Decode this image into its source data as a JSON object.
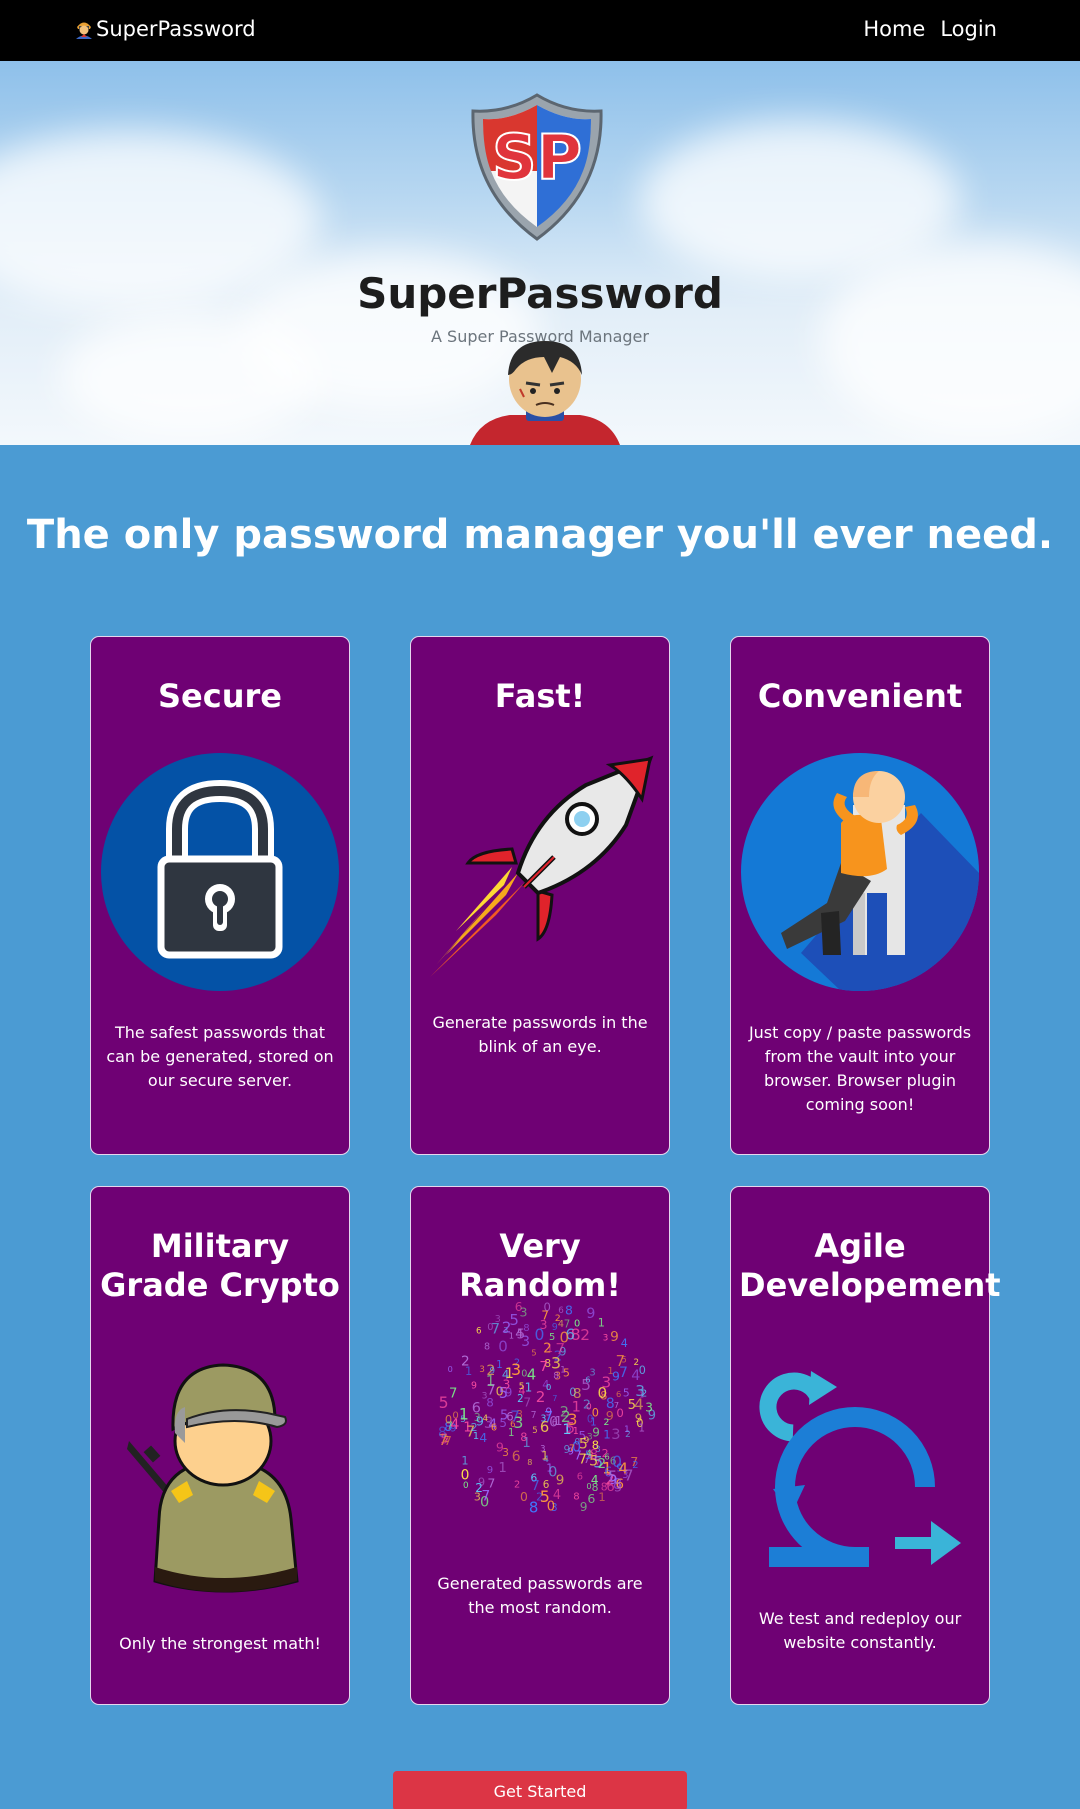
{
  "navbar": {
    "brand": "SuperPassword",
    "brand_icon": "superhero-icon",
    "links": [
      "Home",
      "Login"
    ]
  },
  "hero": {
    "title": "SuperPassword",
    "subtitle": "A Super Password Manager",
    "logo_text": "SP"
  },
  "headline": "The only password manager you'll ever need.",
  "cards": [
    {
      "title": "Secure",
      "icon": "padlock-icon",
      "text": "The safest passwords that can be generated, stored on our secure server."
    },
    {
      "title": "Fast!",
      "icon": "rocket-icon",
      "text": "Generate passwords in the blink of an eye."
    },
    {
      "title": "Convenient",
      "icon": "relaxing-person-icon",
      "text": "Just copy / paste passwords from the vault into your browser. Browser plugin coming soon!"
    },
    {
      "title": "Military Grade Crypto",
      "icon": "soldier-icon",
      "text": "Only the strongest math!"
    },
    {
      "title": "Very Random!",
      "icon": "random-numbers-sphere-icon",
      "text": "Generated passwords are the most random."
    },
    {
      "title": "Agile Developement",
      "icon": "agile-cycle-icon",
      "text": "We test and redeploy our website constantly."
    }
  ],
  "cta": {
    "label": "Get Started"
  },
  "colors": {
    "navbar": "#000000",
    "page_bg": "#4b9bd3",
    "card_bg": "#6f0174",
    "cta": "#dc3545"
  }
}
